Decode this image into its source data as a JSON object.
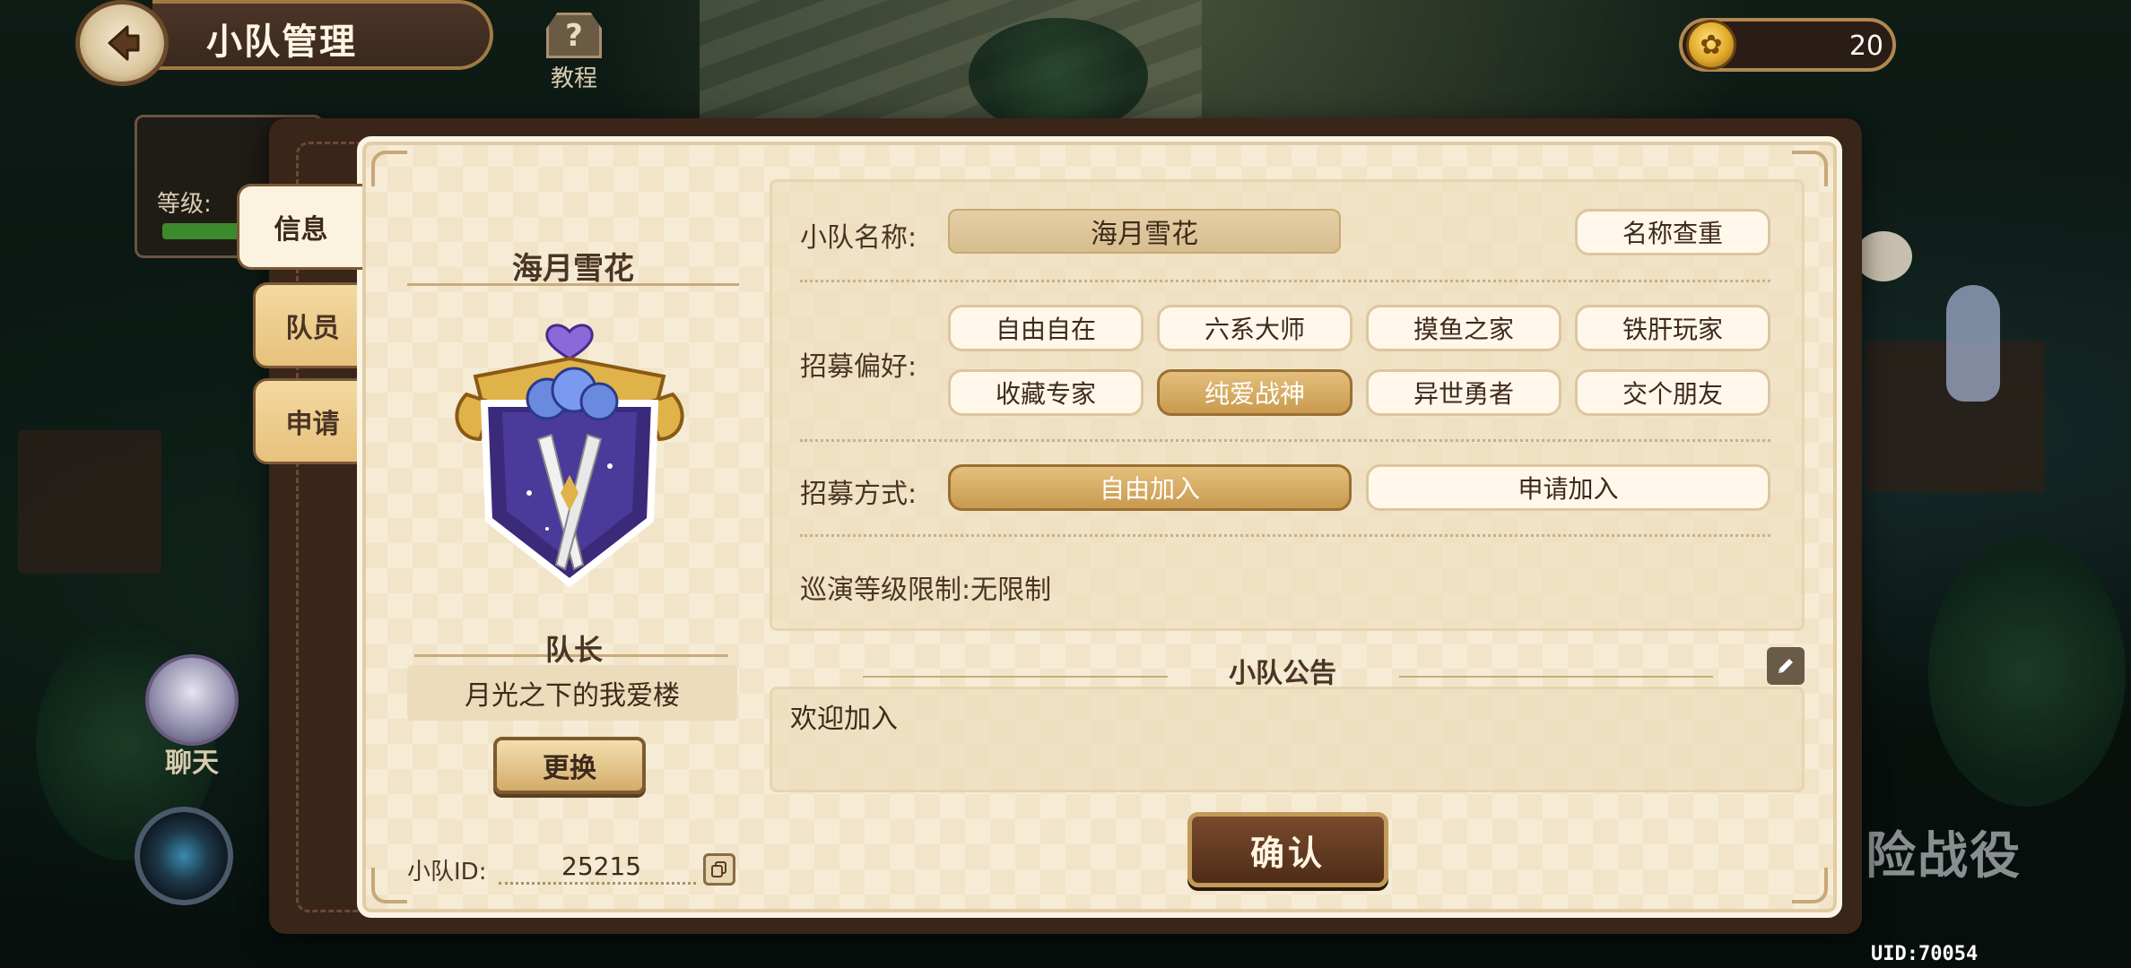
{
  "header": {
    "title": "小队管理",
    "back_icon": "back-arrow-icon",
    "tutorial_label": "教程",
    "currency_value": "20"
  },
  "background": {
    "chat_label": "聊天",
    "level_label": "等级:",
    "adventure_label": "险战役",
    "uid": "UID:70054"
  },
  "tabs": [
    {
      "label": "信息",
      "active": true
    },
    {
      "label": "队员",
      "active": false
    },
    {
      "label": "申请",
      "active": false
    }
  ],
  "team": {
    "name": "海月雪花",
    "leader_title": "队长",
    "leader_name": "月光之下的我爱楼",
    "change_label": "更换",
    "id_label": "小队ID:",
    "id_value": "25215"
  },
  "settings": {
    "name_label": "小队名称:",
    "name_value": "海月雪花",
    "check_name_label": "名称查重",
    "preference_label": "招募偏好:",
    "preferences": [
      {
        "label": "自由自在",
        "selected": false
      },
      {
        "label": "六系大师",
        "selected": false
      },
      {
        "label": "摸鱼之家",
        "selected": false
      },
      {
        "label": "铁肝玩家",
        "selected": false
      },
      {
        "label": "收藏专家",
        "selected": false
      },
      {
        "label": "纯爱战神",
        "selected": true
      },
      {
        "label": "异世勇者",
        "selected": false
      },
      {
        "label": "交个朋友",
        "selected": false
      }
    ],
    "method_label": "招募方式:",
    "methods": [
      {
        "label": "自由加入",
        "selected": true
      },
      {
        "label": "申请加入",
        "selected": false
      }
    ],
    "level_limit": "巡演等级限制:无限制"
  },
  "notice": {
    "title": "小队公告",
    "content": "欢迎加入"
  },
  "confirm_label": "确认",
  "colors": {
    "panel_bg": "#f6ecd6",
    "selected_pill": "#c99a4f",
    "confirm_bg": "#5e3620",
    "frame_dark": "#3a2519"
  }
}
